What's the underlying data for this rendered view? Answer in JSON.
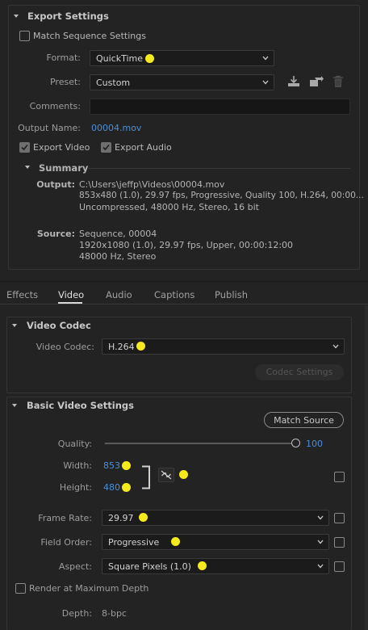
{
  "export_settings": {
    "title": "Export Settings",
    "match_sequence_label": "Match Sequence Settings",
    "format_label": "Format:",
    "format_value": "QuickTime",
    "preset_label": "Preset:",
    "preset_value": "Custom",
    "comments_label": "Comments:",
    "comments_value": "",
    "output_name_label": "Output Name:",
    "output_name_value": "00004.mov",
    "export_video_label": "Export Video",
    "export_video_checked": true,
    "export_audio_label": "Export Audio",
    "export_audio_checked": true
  },
  "summary": {
    "title": "Summary",
    "output_label": "Output:",
    "output_lines": [
      "C:\\Users\\jeffp\\Videos\\00004.mov",
      "853x480 (1.0), 29.97 fps, Progressive, Quality 100, H.264, 00:00...",
      "Uncompressed, 48000 Hz, Stereo, 16 bit"
    ],
    "source_label": "Source:",
    "source_lines": [
      "Sequence, 00004",
      "1920x1080 (1.0), 29.97 fps, Upper, 00:00:12:00",
      "48000 Hz, Stereo"
    ]
  },
  "tabs": [
    {
      "label": "Effects",
      "active": false
    },
    {
      "label": "Video",
      "active": true
    },
    {
      "label": "Audio",
      "active": false
    },
    {
      "label": "Captions",
      "active": false
    },
    {
      "label": "Publish",
      "active": false
    }
  ],
  "video_codec": {
    "title": "Video Codec",
    "codec_label": "Video Codec:",
    "codec_value": "H.264",
    "codec_settings_button": "Codec Settings"
  },
  "basic_video": {
    "title": "Basic Video Settings",
    "match_source_button": "Match Source",
    "quality_label": "Quality:",
    "quality_value": "100",
    "width_label": "Width:",
    "width_value": "853",
    "height_label": "Height:",
    "height_value": "480",
    "frame_rate_label": "Frame Rate:",
    "frame_rate_value": "29.97",
    "field_order_label": "Field Order:",
    "field_order_value": "Progressive",
    "aspect_label": "Aspect:",
    "aspect_value": "Square Pixels (1.0)",
    "render_max_depth_label": "Render at Maximum Depth",
    "depth_label": "Depth:",
    "depth_value": "8-bpc"
  },
  "colors": {
    "background": "#232323",
    "link_blue": "#4a8fd9",
    "highlight_marker": "#f4ea1c"
  }
}
